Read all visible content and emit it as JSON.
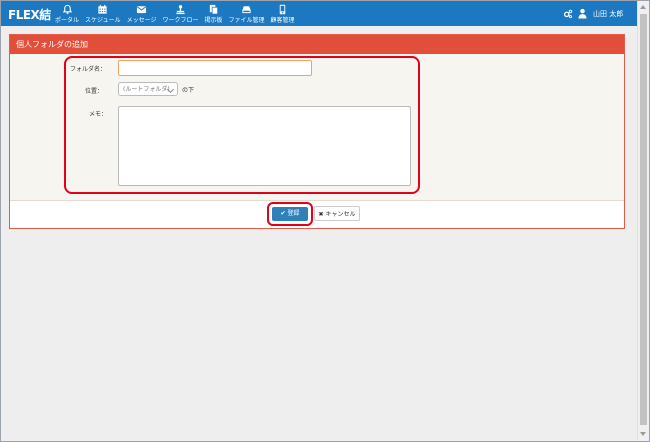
{
  "app": {
    "logo": "FLEX結"
  },
  "nav": [
    {
      "icon": "bell-icon",
      "label": "ポータル"
    },
    {
      "icon": "calendar-icon",
      "label": "スケジュール"
    },
    {
      "icon": "envelope-icon",
      "label": "メッセージ"
    },
    {
      "icon": "workflow-icon",
      "label": "ワークフロー"
    },
    {
      "icon": "board-icon",
      "label": "掲示板"
    },
    {
      "icon": "drive-icon",
      "label": "ファイル管理"
    },
    {
      "icon": "phone-icon",
      "label": "顧客管理"
    }
  ],
  "header_right": {
    "settings_icon": "gear-icon",
    "user_icon": "user-icon",
    "user_name": "山田 太郎"
  },
  "panel": {
    "title": "個人フォルダの追加",
    "name_label": "フォルダ名：",
    "name_value": "",
    "location_label": "位置：",
    "location_value": "(ルートフォルダ)",
    "location_suffix": "の下",
    "memo_label": "メモ：",
    "memo_value": ""
  },
  "buttons": {
    "save_label": "登録",
    "save_icon": "check-icon",
    "cancel_label": "キャンセル",
    "cancel_icon": "x-icon"
  },
  "colors": {
    "topbar": "#1b78c1",
    "panel_header": "#e14e3a",
    "highlight": "#e2001a",
    "save_button": "#2f80b9"
  }
}
